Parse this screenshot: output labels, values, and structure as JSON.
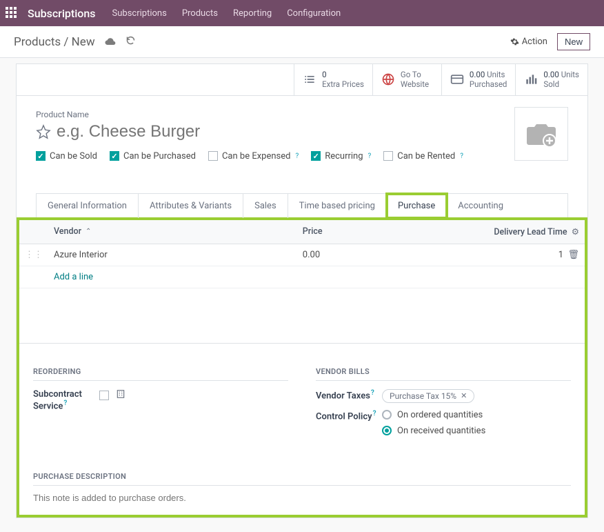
{
  "nav": {
    "brand": "Subscriptions",
    "items": [
      "Subscriptions",
      "Products",
      "Reporting",
      "Configuration"
    ]
  },
  "toolbar": {
    "breadcrumb_root": "Products",
    "breadcrumb_current": "New",
    "action_label": "Action",
    "new_label": "New"
  },
  "stats": {
    "extra_prices": {
      "value": "0",
      "label": "Extra Prices"
    },
    "website": {
      "line1": "Go To",
      "line2": "Website"
    },
    "purchased": {
      "value": "0.00",
      "unit": "Units",
      "label": "Purchased"
    },
    "sold": {
      "value": "0.00",
      "unit": "Units",
      "label": "Sold"
    }
  },
  "product": {
    "name_label": "Product Name",
    "name_placeholder": "e.g. Cheese Burger",
    "checks": {
      "sold": {
        "label": "Can be Sold",
        "checked": true
      },
      "purchased": {
        "label": "Can be Purchased",
        "checked": true
      },
      "expensed": {
        "label": "Can be Expensed",
        "checked": false
      },
      "recurring": {
        "label": "Recurring",
        "checked": true
      },
      "rented": {
        "label": "Can be Rented",
        "checked": false
      }
    }
  },
  "tabs": [
    "General Information",
    "Attributes & Variants",
    "Sales",
    "Time based pricing",
    "Purchase",
    "Accounting"
  ],
  "active_tab": "Purchase",
  "purchase": {
    "columns": {
      "vendor": "Vendor",
      "price": "Price",
      "lead": "Delivery Lead Time"
    },
    "rows": [
      {
        "vendor": "Azure Interior",
        "price": "0.00",
        "lead": "1"
      }
    ],
    "add_line": "Add a line",
    "reordering": {
      "title": "REORDERING",
      "subcontract_label": "Subcontract Service"
    },
    "vendor_bills": {
      "title": "VENDOR BILLS",
      "taxes_label": "Vendor Taxes",
      "taxes_tag": "Purchase Tax 15%",
      "policy_label": "Control Policy",
      "policy_options": [
        "On ordered quantities",
        "On received quantities"
      ],
      "policy_selected": "On received quantities"
    },
    "description": {
      "title": "PURCHASE DESCRIPTION",
      "placeholder": "This note is added to purchase orders."
    }
  }
}
